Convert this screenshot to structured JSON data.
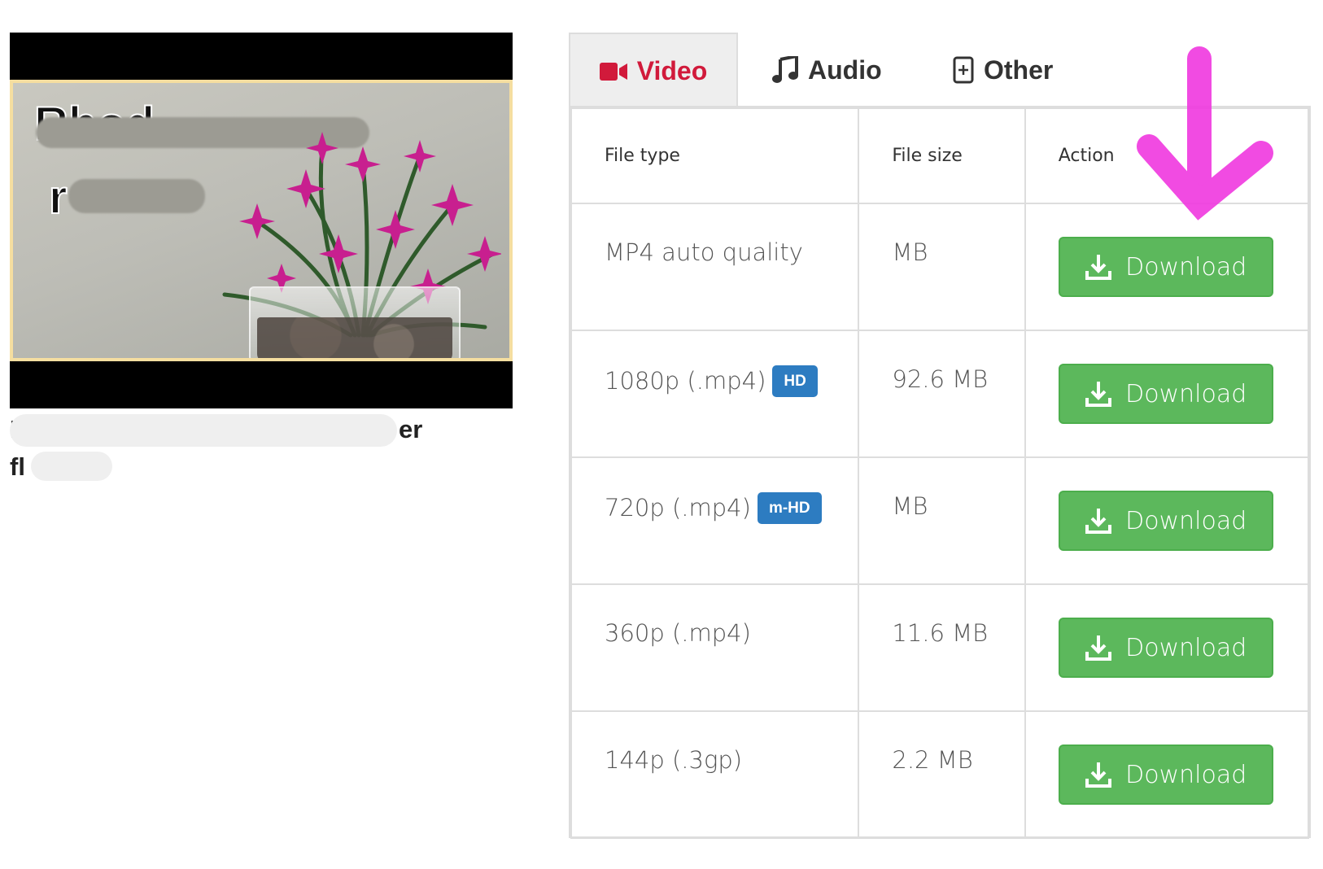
{
  "video": {
    "thumbnail_text": [
      "Rhod",
      "r"
    ],
    "caption_line1": "Rh",
    "caption_line1_end": "er",
    "caption_line2": "fl"
  },
  "tabs": [
    {
      "label": "Video",
      "icon": "video-camera-icon",
      "active": true
    },
    {
      "label": "Audio",
      "icon": "music-note-icon",
      "active": false
    },
    {
      "label": "Other",
      "icon": "file-plus-icon",
      "active": false
    }
  ],
  "table": {
    "headers": {
      "file_type": "File type",
      "file_size": "File size",
      "action": "Action"
    },
    "rows": [
      {
        "type": "MP4 auto quality",
        "badge": "",
        "size": "MB",
        "action": "Download"
      },
      {
        "type": "1080p (.mp4)",
        "badge": "HD",
        "size": "92.6 MB",
        "action": "Download"
      },
      {
        "type": "720p (.mp4)",
        "badge": "m-HD",
        "size": "MB",
        "action": "Download"
      },
      {
        "type": "360p (.mp4)",
        "badge": "",
        "size": "11.6 MB",
        "action": "Download"
      },
      {
        "type": "144p (.3gp)",
        "badge": "",
        "size": "2.2 MB",
        "action": "Download"
      }
    ]
  },
  "colors": {
    "accent_red": "#d11a3b",
    "download_green": "#5cb85c",
    "badge_blue": "#2d7cc1",
    "annotation_magenta": "#f03ce0"
  }
}
